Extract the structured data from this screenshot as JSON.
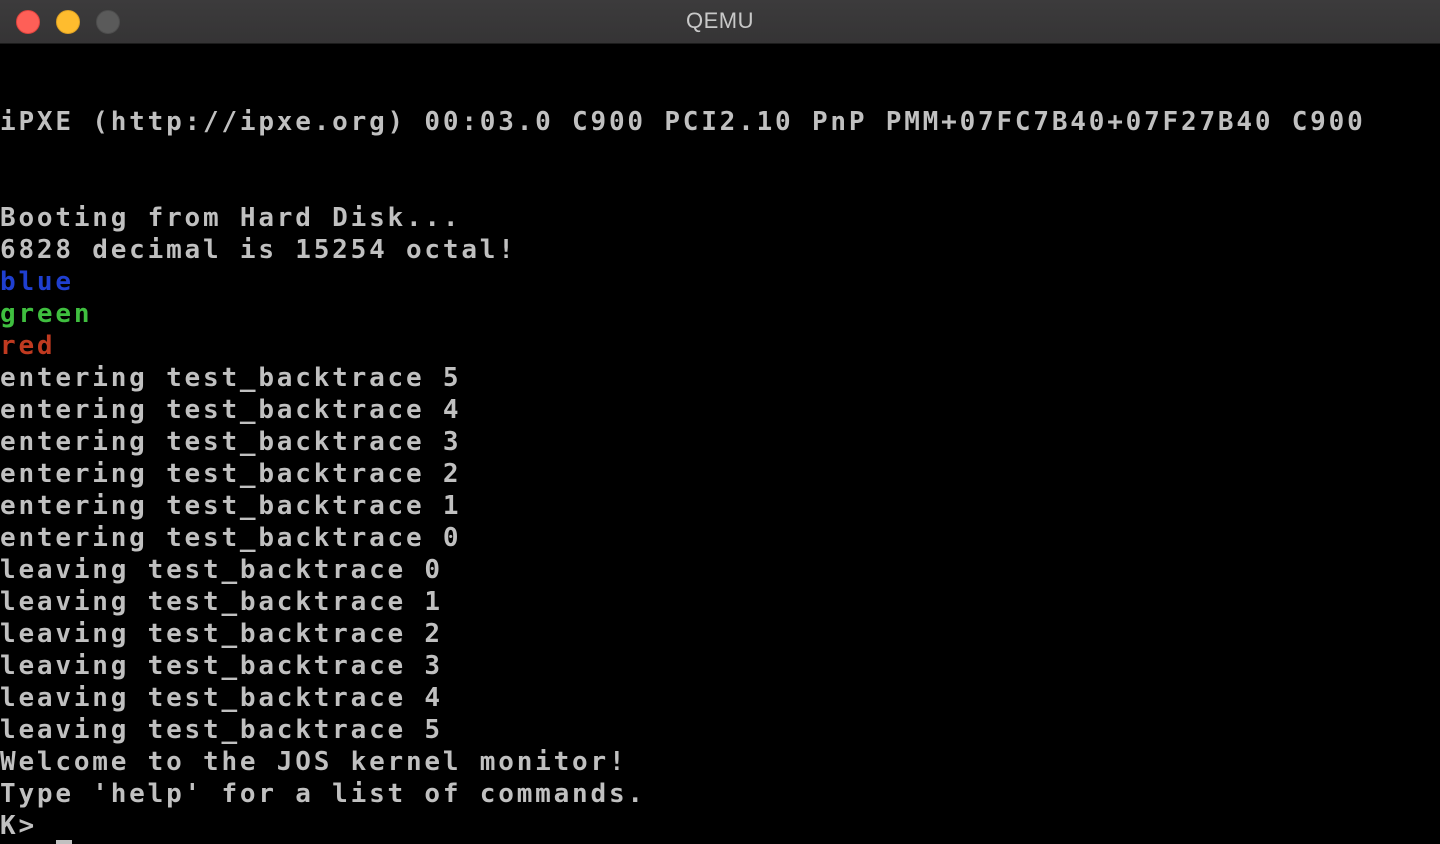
{
  "window": {
    "title": "QEMU"
  },
  "colors": {
    "default_text": "#c0c0c0",
    "blue": "#1f3fd0",
    "green": "#3fbf3f",
    "red": "#c03a20"
  },
  "console": {
    "ipxe_banner": "iPXE (http://ipxe.org) 00:03.0 C900 PCI2.10 PnP PMM+07FC7B40+07F27B40 C900",
    "booting": "Booting from Hard Disk...",
    "octal": "6828 decimal is 15254 octal!",
    "blue": "blue",
    "green": "green",
    "red": "red",
    "entering": [
      "entering test_backtrace 5",
      "entering test_backtrace 4",
      "entering test_backtrace 3",
      "entering test_backtrace 2",
      "entering test_backtrace 1",
      "entering test_backtrace 0"
    ],
    "leaving": [
      "leaving test_backtrace 0",
      "leaving test_backtrace 1",
      "leaving test_backtrace 2",
      "leaving test_backtrace 3",
      "leaving test_backtrace 4",
      "leaving test_backtrace 5"
    ],
    "welcome": "Welcome to the JOS kernel monitor!",
    "help_hint": "Type 'help' for a list of commands.",
    "prompt": "K>"
  }
}
